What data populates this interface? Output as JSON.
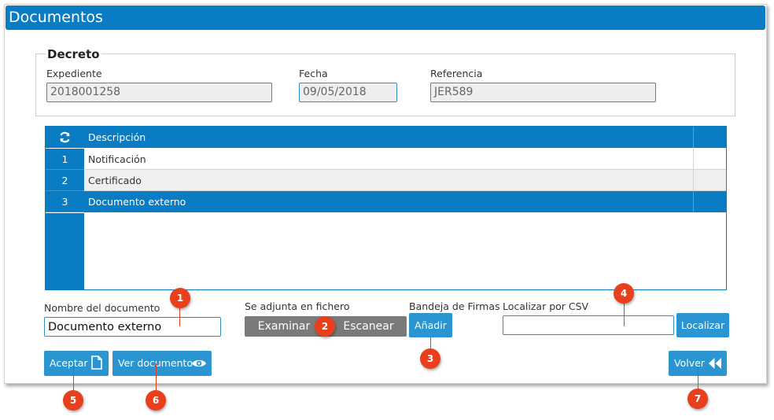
{
  "window": {
    "title": "Documentos"
  },
  "decreto": {
    "legend": "Decreto",
    "expediente_label": "Expediente",
    "expediente_value": "2018001258",
    "fecha_label": "Fecha",
    "fecha_value": "09/05/2018",
    "referencia_label": "Referencia",
    "referencia_value": "JER589"
  },
  "grid": {
    "header": "Descripción",
    "rows": [
      {
        "num": "1",
        "desc": "Notificación"
      },
      {
        "num": "2",
        "desc": "Certificado"
      },
      {
        "num": "3",
        "desc": "Documento externo"
      }
    ]
  },
  "form": {
    "nombre_label": "Nombre del documento",
    "nombre_value": "Documento externo",
    "adjunta_label": "Se adjunta en fichero",
    "examinar_label": "Examinar",
    "escanear_label": "Escanear",
    "bandeja_label": "Bandeja de Firmas",
    "anadir_label": "Añadir",
    "csv_label": "Localizar por CSV",
    "csv_value": "",
    "localizar_label": "Localizar"
  },
  "footer": {
    "aceptar_label": "Aceptar",
    "ver_label": "Ver documento",
    "volver_label": "Volver"
  },
  "callouts": [
    "1",
    "2",
    "3",
    "4",
    "5",
    "6",
    "7"
  ],
  "icons": {
    "refresh": "refresh-icon",
    "document": "document-icon",
    "eye": "eye-icon",
    "back": "double-chevron-left-icon"
  },
  "colors": {
    "primary": "#0a7cc3",
    "button": "#2a95d0",
    "callout": "#e8401c",
    "gray_button": "#7a7a7a"
  }
}
